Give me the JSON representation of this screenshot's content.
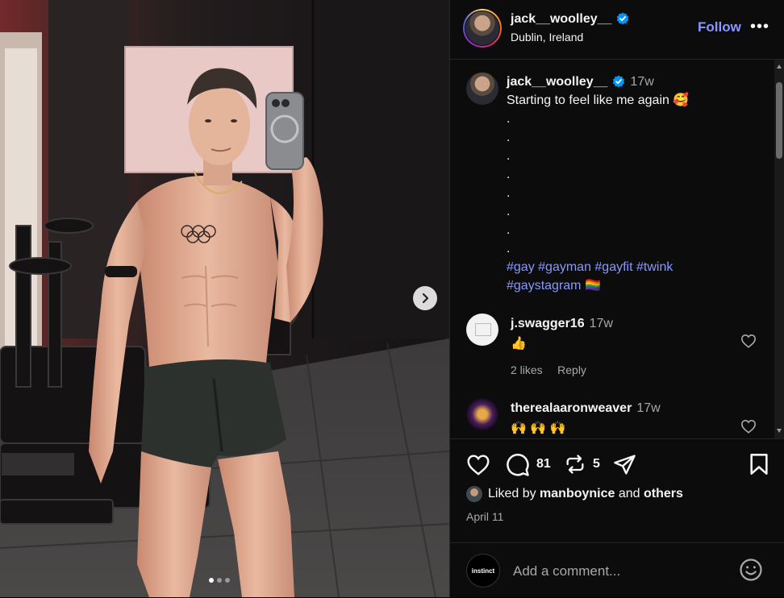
{
  "post": {
    "username": "jack__woolley__",
    "location": "Dublin, Ireland",
    "follow_label": "Follow",
    "more_label": "•••",
    "image_count": 3,
    "current_image": 1
  },
  "caption": {
    "username": "jack__woolley__",
    "time": "17w",
    "text": "Starting to feel like me again 🥰",
    "dots": [
      ".",
      ".",
      ".",
      ".",
      ".",
      ".",
      ".",
      "."
    ],
    "hashtags_line1": "#gay #gayman #gayfit #twink",
    "hashtags_line2": "#gaystagram",
    "flag": "🏳️‍🌈"
  },
  "comments": [
    {
      "username": "j.swagger16",
      "time": "17w",
      "text": "👍",
      "likes": "2 likes",
      "reply": "Reply"
    },
    {
      "username": "therealaaronweaver",
      "time": "17w",
      "text": "🙌 🙌 🙌"
    }
  ],
  "actions": {
    "comment_count": "81",
    "repost_count": "5",
    "liked_by_prefix": "Liked by",
    "liked_by_user": "manboynice",
    "liked_by_and": "and",
    "liked_by_others": "others",
    "date": "April 11"
  },
  "add_comment": {
    "placeholder": "Add a comment...",
    "avatar_text": "instinct"
  },
  "colors": {
    "accent": "#8898ff",
    "verified": "#0095f6",
    "background": "#0c0c0c",
    "muted": "#a8a8a8"
  },
  "icons": [
    "verified-badge-icon",
    "heart-icon",
    "comment-icon",
    "repost-icon",
    "share-icon",
    "bookmark-icon",
    "emoji-icon",
    "chevron-right-icon"
  ]
}
